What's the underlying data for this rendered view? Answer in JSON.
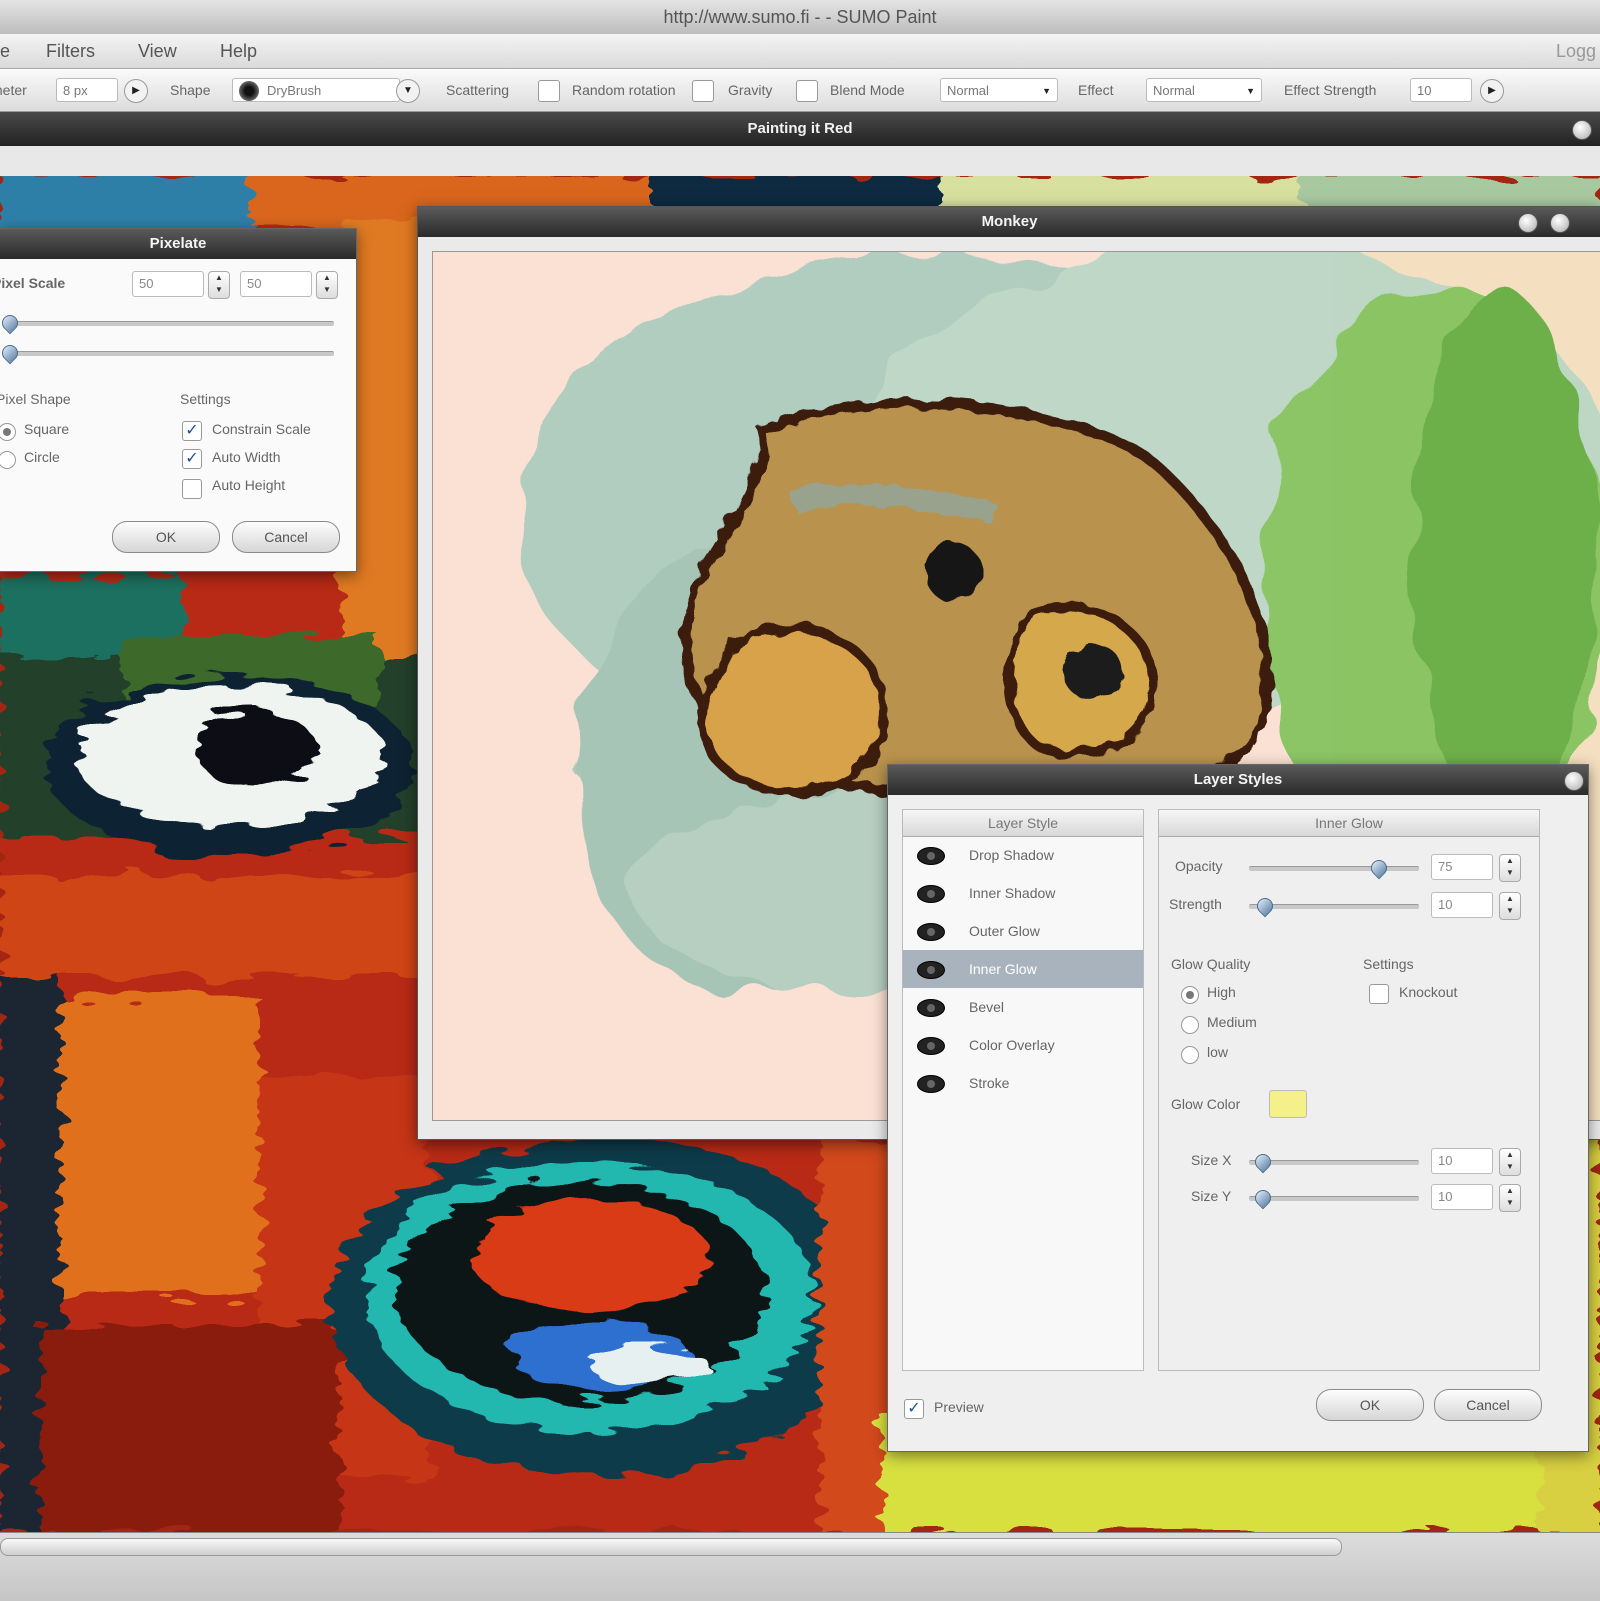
{
  "browser": {
    "title": "http://www.sumo.fi - - SUMO Paint"
  },
  "menu": {
    "items": [
      "Filters",
      "View",
      "Help"
    ],
    "cut_left": "e",
    "cut_right": "Logg"
  },
  "options": {
    "size_label": "Diameter",
    "size_value": "8 px",
    "shape_label": "Shape",
    "shape_value": "DryBrush",
    "scattering_label": "Scattering",
    "random_rotation_label": "Random rotation",
    "gravity_label": "Gravity",
    "blend_mode_label": "Blend Mode",
    "blend_mode_value": "Normal",
    "effect_label": "Effect",
    "effect_value": "Normal",
    "effect_strength_label": "Effect Strength",
    "effect_strength_value": "10"
  },
  "document": {
    "title": "Painting it Red"
  },
  "monkey_window": {
    "title": "Monkey"
  },
  "pixelate": {
    "title": "Pixelate",
    "pixel_scale_label": "Pixel Scale",
    "scale_x": "50",
    "scale_y": "50",
    "pixel_shape_label": "Pixel Shape",
    "shape_options": [
      "Square",
      "Circle"
    ],
    "selected_shape": "Square",
    "settings_label": "Settings",
    "settings": [
      {
        "label": "Constrain Scale",
        "checked": true
      },
      {
        "label": "Auto Width",
        "checked": true
      },
      {
        "label": "Auto Height",
        "checked": false
      }
    ],
    "ok_label": "OK",
    "cancel_label": "Cancel"
  },
  "layer_styles": {
    "title": "Layer Styles",
    "list_header": "Layer Style",
    "styles": [
      "Drop Shadow",
      "Inner Shadow",
      "Outer Glow",
      "Inner Glow",
      "Bevel",
      "Color Overlay",
      "Stroke"
    ],
    "selected_style": "Inner Glow",
    "detail_header": "Inner Glow",
    "opacity_label": "Opacity",
    "opacity_value": "75",
    "strength_label": "Strength",
    "strength_value": "10",
    "glow_quality_label": "Glow Quality",
    "quality_options": [
      "High",
      "Medium",
      "low"
    ],
    "selected_quality": "High",
    "settings_label": "Settings",
    "knockout_label": "Knockout",
    "glow_color_label": "Glow Color",
    "glow_color": "#f6f08a",
    "size_x_label": "Size X",
    "size_x_value": "10",
    "size_y_label": "Size Y",
    "size_y_value": "10",
    "preview_label": "Preview",
    "preview_checked": true,
    "ok_label": "OK",
    "cancel_label": "Cancel"
  }
}
